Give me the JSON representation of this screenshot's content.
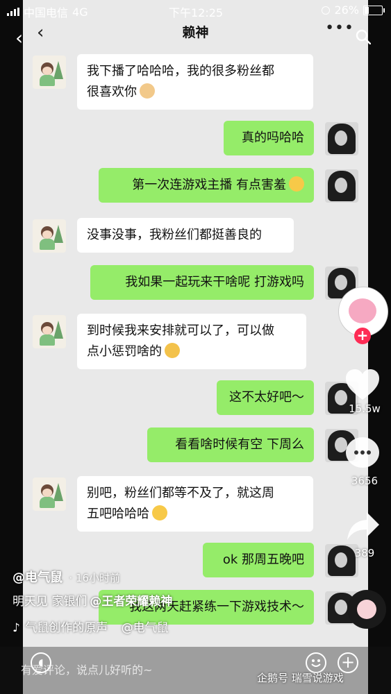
{
  "status_bar": {
    "carrier": "中国电信",
    "network": "4G",
    "time": "下午12:25",
    "battery": "26%"
  },
  "chat": {
    "title": "赖神",
    "messages": [
      {
        "side": "left",
        "lines": [
          "我下播了哈哈哈，我的很多粉丝都",
          "很喜欢你"
        ],
        "emoji": "doge-emoji"
      },
      {
        "side": "right",
        "lines": [
          "真的吗哈哈"
        ]
      },
      {
        "side": "right",
        "lines": [
          "第一次连游戏主播 有点害羞"
        ],
        "emoji": "shy-emoji"
      },
      {
        "side": "left",
        "lines": [
          "没事没事，我粉丝们都挺善良的"
        ]
      },
      {
        "side": "right",
        "lines": [
          "我如果一起玩来干啥呢 打游戏吗"
        ]
      },
      {
        "side": "left",
        "lines": [
          "到时候我来安排就可以了，可以做",
          "点小惩罚啥的"
        ],
        "emoji": "smirk-emoji"
      },
      {
        "side": "right",
        "lines": [
          "这不太好吧～"
        ]
      },
      {
        "side": "right",
        "lines": [
          "看看啥时候有空 下周么"
        ]
      },
      {
        "side": "left",
        "lines": [
          "别吧，粉丝们都等不及了，就这周",
          "五吧哈哈哈"
        ],
        "emoji": "grin-emoji"
      },
      {
        "side": "right",
        "lines": [
          "ok 那周五晚吧"
        ]
      },
      {
        "side": "right",
        "lines": [
          "我这两天赶紧练一下游戏技术～"
        ]
      }
    ]
  },
  "video": {
    "author": "@电气鼠",
    "time_ago": "· 16小时前",
    "desc_prefix": "明天见 家银们",
    "mention": "@王者荣耀赖神",
    "music_note": "♪",
    "music": "气鼠创作的原声",
    "music_author": "@电气鼠",
    "likes": "15.5w",
    "comments": "3656",
    "shares": "389"
  },
  "comment_bar": {
    "placeholder": "有爱评论，说点儿好听的~"
  },
  "watermark": "企鹅号 瑞雪说游戏"
}
